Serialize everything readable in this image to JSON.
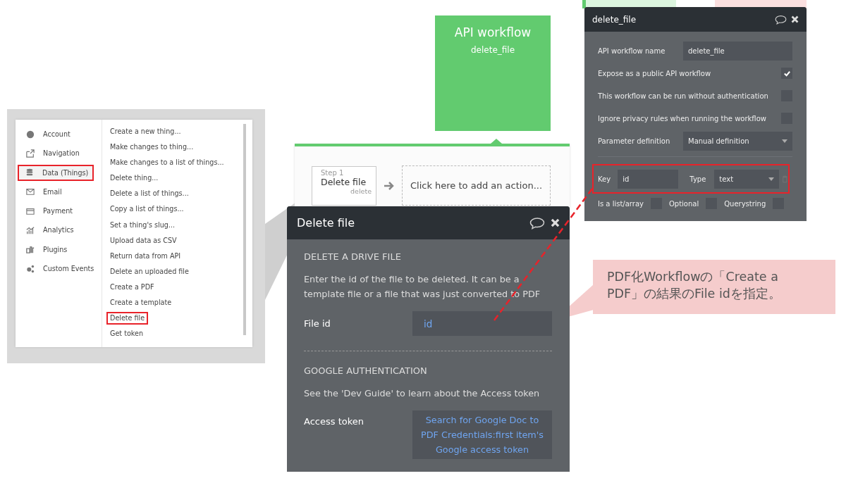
{
  "action_menu": {
    "categories": [
      {
        "label": "Account",
        "selected": false
      },
      {
        "label": "Navigation",
        "selected": false
      },
      {
        "label": "Data (Things)",
        "selected": true
      },
      {
        "label": "Email",
        "selected": false
      },
      {
        "label": "Payment",
        "selected": false
      },
      {
        "label": "Analytics",
        "selected": false
      },
      {
        "label": "Plugins",
        "selected": false
      },
      {
        "label": "Custom Events",
        "selected": false
      }
    ],
    "actions": [
      {
        "label": "Create a new thing...",
        "selected": false
      },
      {
        "label": "Make changes to thing...",
        "selected": false
      },
      {
        "label": "Make changes to a list of things...",
        "selected": false
      },
      {
        "label": "Delete thing...",
        "selected": false
      },
      {
        "label": "Delete a list of things...",
        "selected": false
      },
      {
        "label": "Copy a list of things...",
        "selected": false
      },
      {
        "label": "Set a thing's slug...",
        "selected": false
      },
      {
        "label": "Upload data as CSV",
        "selected": false
      },
      {
        "label": "Return data from API",
        "selected": false
      },
      {
        "label": "Delete an uploaded file",
        "selected": false
      },
      {
        "label": "Create a PDF",
        "selected": false
      },
      {
        "label": "Create a template",
        "selected": false
      },
      {
        "label": "Delete file",
        "selected": true
      },
      {
        "label": "Get token",
        "selected": false
      }
    ]
  },
  "api_workflow_block": {
    "title": "API workflow",
    "name": "delete_file"
  },
  "workflow_steps": {
    "step": {
      "number": "Step 1",
      "title": "Delete file",
      "subtitle": "delete"
    },
    "add_action": "Click here to add an action..."
  },
  "action_panel": {
    "title": "Delete file",
    "section_heading": "DELETE A DRIVE FILE",
    "description": "Enter the id of the file to be deleted. It can be a template file or a file that was just converted to PDF",
    "file_id": {
      "label": "File id",
      "value": "id"
    },
    "auth_heading": "GOOGLE AUTHENTICATION",
    "auth_note": "See the 'Dev Guide' to learn about the Access token",
    "access_token": {
      "label": "Access token",
      "value": "Search for Google Doc to PDF Credentials:first item's Google access token"
    }
  },
  "workflow_panel": {
    "title": "delete_file",
    "name_label": "API workflow name",
    "name_value": "delete_file",
    "options": [
      {
        "label": "Expose as a public API workflow",
        "checked": true
      },
      {
        "label": "This workflow can be run without authentication",
        "checked": false
      },
      {
        "label": "Ignore privacy rules when running the workflow",
        "checked": false
      }
    ],
    "parameter_definition": {
      "label": "Parameter definition",
      "value": "Manual definition"
    },
    "parameter": {
      "key_label": "Key",
      "key_value": "id",
      "type_label": "Type",
      "type_value": "text"
    },
    "flags": [
      {
        "label": "Is a list/array",
        "checked": false
      },
      {
        "label": "Optional",
        "checked": false
      },
      {
        "label": "Querystring",
        "checked": false
      }
    ]
  },
  "callout": {
    "text": "PDF化Workflowの「Create a PDF」の結果のFile idを指定。"
  }
}
